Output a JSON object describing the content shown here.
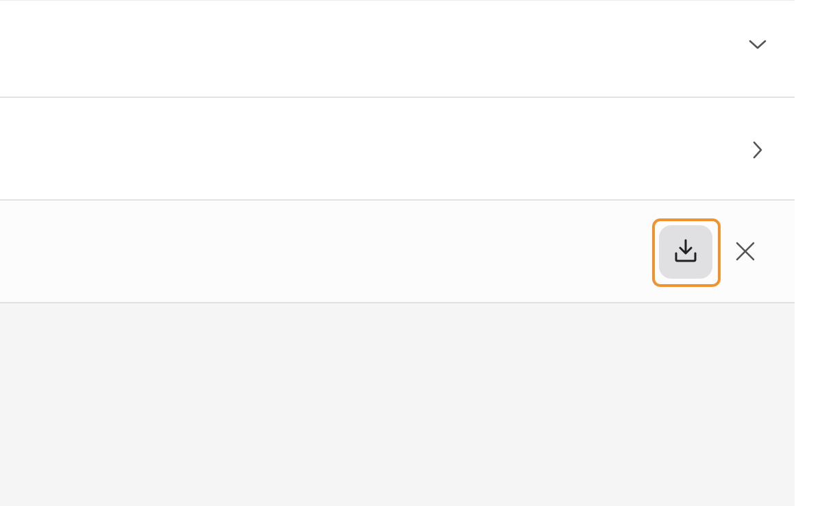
{
  "rows": [
    {
      "icon": "chevron-down-icon"
    },
    {
      "icon": "chevron-right-icon"
    },
    {
      "actions": [
        "download-icon",
        "close-icon"
      ]
    }
  ],
  "colors": {
    "highlight": "#f0922e",
    "icon": "#555555",
    "download_button_bg": "#e0e0e2",
    "divider": "#e2e2e2",
    "empty_area_bg": "#f5f5f5"
  }
}
